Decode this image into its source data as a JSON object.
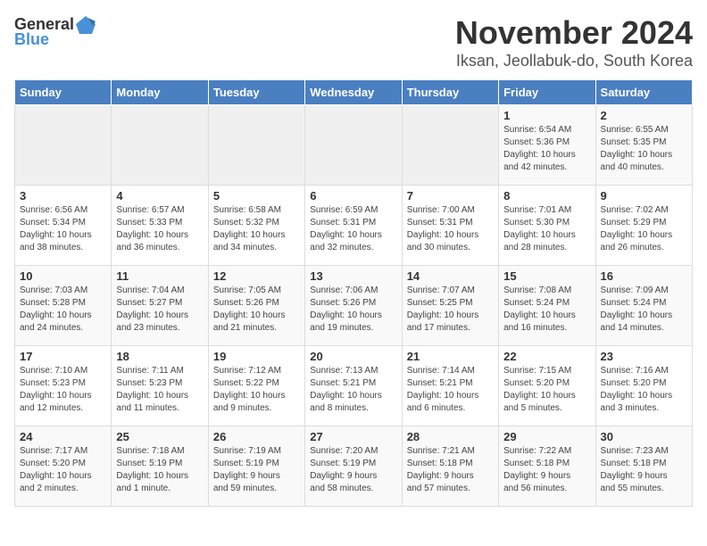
{
  "header": {
    "logo_general": "General",
    "logo_blue": "Blue",
    "title": "November 2024",
    "subtitle": "Iksan, Jeollabuk-do, South Korea"
  },
  "weekdays": [
    "Sunday",
    "Monday",
    "Tuesday",
    "Wednesday",
    "Thursday",
    "Friday",
    "Saturday"
  ],
  "weeks": [
    [
      {
        "day": "",
        "info": ""
      },
      {
        "day": "",
        "info": ""
      },
      {
        "day": "",
        "info": ""
      },
      {
        "day": "",
        "info": ""
      },
      {
        "day": "",
        "info": ""
      },
      {
        "day": "1",
        "info": "Sunrise: 6:54 AM\nSunset: 5:36 PM\nDaylight: 10 hours\nand 42 minutes."
      },
      {
        "day": "2",
        "info": "Sunrise: 6:55 AM\nSunset: 5:35 PM\nDaylight: 10 hours\nand 40 minutes."
      }
    ],
    [
      {
        "day": "3",
        "info": "Sunrise: 6:56 AM\nSunset: 5:34 PM\nDaylight: 10 hours\nand 38 minutes."
      },
      {
        "day": "4",
        "info": "Sunrise: 6:57 AM\nSunset: 5:33 PM\nDaylight: 10 hours\nand 36 minutes."
      },
      {
        "day": "5",
        "info": "Sunrise: 6:58 AM\nSunset: 5:32 PM\nDaylight: 10 hours\nand 34 minutes."
      },
      {
        "day": "6",
        "info": "Sunrise: 6:59 AM\nSunset: 5:31 PM\nDaylight: 10 hours\nand 32 minutes."
      },
      {
        "day": "7",
        "info": "Sunrise: 7:00 AM\nSunset: 5:31 PM\nDaylight: 10 hours\nand 30 minutes."
      },
      {
        "day": "8",
        "info": "Sunrise: 7:01 AM\nSunset: 5:30 PM\nDaylight: 10 hours\nand 28 minutes."
      },
      {
        "day": "9",
        "info": "Sunrise: 7:02 AM\nSunset: 5:29 PM\nDaylight: 10 hours\nand 26 minutes."
      }
    ],
    [
      {
        "day": "10",
        "info": "Sunrise: 7:03 AM\nSunset: 5:28 PM\nDaylight: 10 hours\nand 24 minutes."
      },
      {
        "day": "11",
        "info": "Sunrise: 7:04 AM\nSunset: 5:27 PM\nDaylight: 10 hours\nand 23 minutes."
      },
      {
        "day": "12",
        "info": "Sunrise: 7:05 AM\nSunset: 5:26 PM\nDaylight: 10 hours\nand 21 minutes."
      },
      {
        "day": "13",
        "info": "Sunrise: 7:06 AM\nSunset: 5:26 PM\nDaylight: 10 hours\nand 19 minutes."
      },
      {
        "day": "14",
        "info": "Sunrise: 7:07 AM\nSunset: 5:25 PM\nDaylight: 10 hours\nand 17 minutes."
      },
      {
        "day": "15",
        "info": "Sunrise: 7:08 AM\nSunset: 5:24 PM\nDaylight: 10 hours\nand 16 minutes."
      },
      {
        "day": "16",
        "info": "Sunrise: 7:09 AM\nSunset: 5:24 PM\nDaylight: 10 hours\nand 14 minutes."
      }
    ],
    [
      {
        "day": "17",
        "info": "Sunrise: 7:10 AM\nSunset: 5:23 PM\nDaylight: 10 hours\nand 12 minutes."
      },
      {
        "day": "18",
        "info": "Sunrise: 7:11 AM\nSunset: 5:23 PM\nDaylight: 10 hours\nand 11 minutes."
      },
      {
        "day": "19",
        "info": "Sunrise: 7:12 AM\nSunset: 5:22 PM\nDaylight: 10 hours\nand 9 minutes."
      },
      {
        "day": "20",
        "info": "Sunrise: 7:13 AM\nSunset: 5:21 PM\nDaylight: 10 hours\nand 8 minutes."
      },
      {
        "day": "21",
        "info": "Sunrise: 7:14 AM\nSunset: 5:21 PM\nDaylight: 10 hours\nand 6 minutes."
      },
      {
        "day": "22",
        "info": "Sunrise: 7:15 AM\nSunset: 5:20 PM\nDaylight: 10 hours\nand 5 minutes."
      },
      {
        "day": "23",
        "info": "Sunrise: 7:16 AM\nSunset: 5:20 PM\nDaylight: 10 hours\nand 3 minutes."
      }
    ],
    [
      {
        "day": "24",
        "info": "Sunrise: 7:17 AM\nSunset: 5:20 PM\nDaylight: 10 hours\nand 2 minutes."
      },
      {
        "day": "25",
        "info": "Sunrise: 7:18 AM\nSunset: 5:19 PM\nDaylight: 10 hours\nand 1 minute."
      },
      {
        "day": "26",
        "info": "Sunrise: 7:19 AM\nSunset: 5:19 PM\nDaylight: 9 hours\nand 59 minutes."
      },
      {
        "day": "27",
        "info": "Sunrise: 7:20 AM\nSunset: 5:19 PM\nDaylight: 9 hours\nand 58 minutes."
      },
      {
        "day": "28",
        "info": "Sunrise: 7:21 AM\nSunset: 5:18 PM\nDaylight: 9 hours\nand 57 minutes."
      },
      {
        "day": "29",
        "info": "Sunrise: 7:22 AM\nSunset: 5:18 PM\nDaylight: 9 hours\nand 56 minutes."
      },
      {
        "day": "30",
        "info": "Sunrise: 7:23 AM\nSunset: 5:18 PM\nDaylight: 9 hours\nand 55 minutes."
      }
    ]
  ]
}
